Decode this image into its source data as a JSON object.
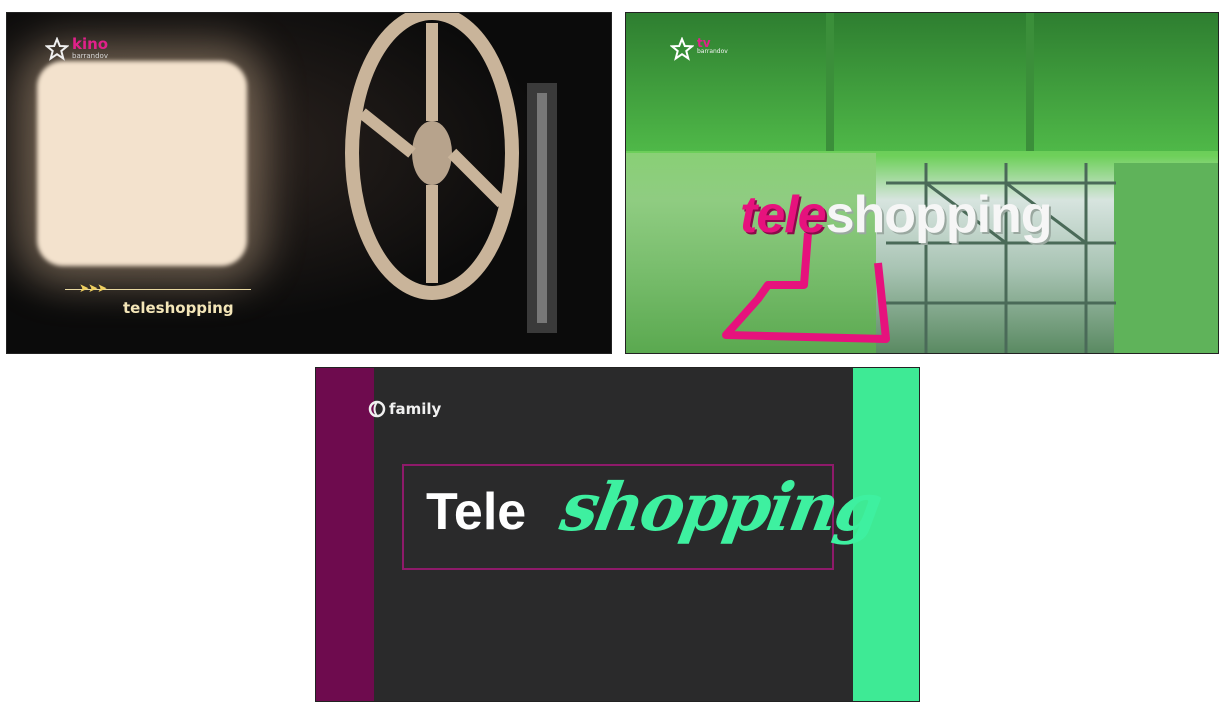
{
  "panels": [
    {
      "name": "kino-barrandov",
      "logo_main": "kino",
      "logo_sub": "barrandov",
      "caption": "teleshopping",
      "icons": [
        "star-icon",
        "arrows-icon"
      ],
      "colors": {
        "accent": "#e0218a",
        "caption": "#f4e6b8"
      }
    },
    {
      "name": "tv-barrandov",
      "logo_main": "tv",
      "logo_sub": "barrandov",
      "title_part1": "tele",
      "title_part2": "shopping",
      "icons": [
        "star-icon"
      ],
      "colors": {
        "accent": "#e6127d",
        "green": "#58c050"
      }
    },
    {
      "name": "family",
      "logo_text": "family",
      "title_part1": "Tele",
      "title_part2": "shopping",
      "icons": [
        "family-logo-icon"
      ],
      "colors": {
        "left_bar": "#6e0b4e",
        "right_bar": "#3eea95",
        "frame": "#8e1a6a",
        "script": "#3ef0a0"
      }
    }
  ]
}
